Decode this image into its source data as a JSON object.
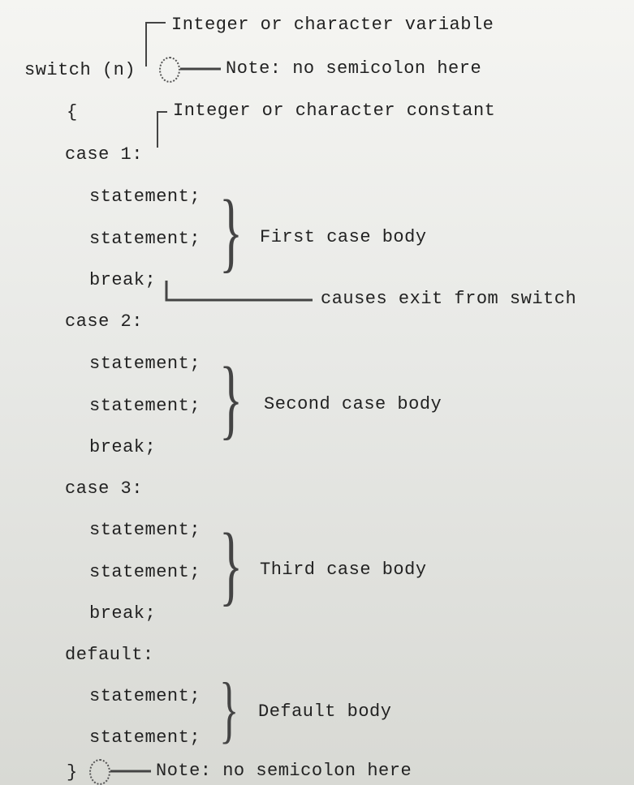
{
  "annotations": {
    "var_type": "Integer or character variable",
    "no_semicolon_top": "Note: no semicolon here",
    "const_type": "Integer or character constant",
    "first_body": "First case body",
    "exit_switch": "causes exit from switch",
    "second_body": "Second case body",
    "third_body": "Third case body",
    "default_body": "Default body",
    "no_semicolon_bottom": "Note: no semicolon here"
  },
  "code": {
    "switch": "switch (n)",
    "open": "{",
    "case1": "case 1:",
    "case2": "case 2:",
    "case3": "case 3:",
    "default": "default:",
    "statement": "statement;",
    "break": "break;",
    "close": "}"
  }
}
